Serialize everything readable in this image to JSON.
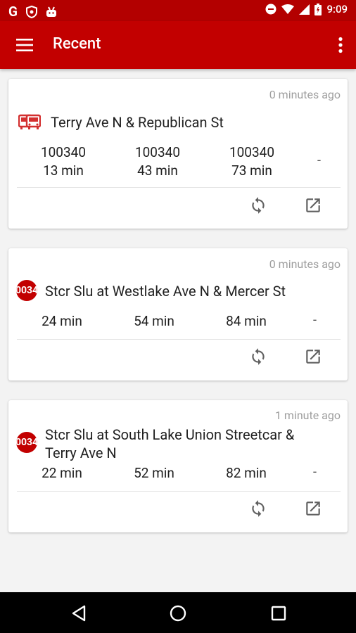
{
  "status_bar": {
    "time": "9:09"
  },
  "app_bar": {
    "title": "Recent"
  },
  "cards": [
    {
      "ago": "0 minutes ago",
      "stop": "Terry Ave N & Republican St",
      "arrivals": [
        {
          "route": "100340",
          "time": "13 min"
        },
        {
          "route": "100340",
          "time": "43 min"
        },
        {
          "route": "100340",
          "time": "73 min"
        }
      ],
      "extra": "-"
    },
    {
      "ago": "0 minutes ago",
      "badge": "0034",
      "stop": "Stcr Slu at Westlake Ave N & Mercer St",
      "arrivals": [
        {
          "time": "24 min"
        },
        {
          "time": "54 min"
        },
        {
          "time": "84 min"
        }
      ],
      "extra": "-"
    },
    {
      "ago": "1 minute ago",
      "badge": "0034",
      "stop_line1": "Stcr Slu at South Lake Union Streetcar &",
      "stop_line2": "Terry Ave N",
      "arrivals": [
        {
          "time": "22 min"
        },
        {
          "time": "52 min"
        },
        {
          "time": "82 min"
        }
      ],
      "extra": "-"
    }
  ],
  "colors": {
    "primary": "#c20000",
    "status": "#b30000"
  }
}
